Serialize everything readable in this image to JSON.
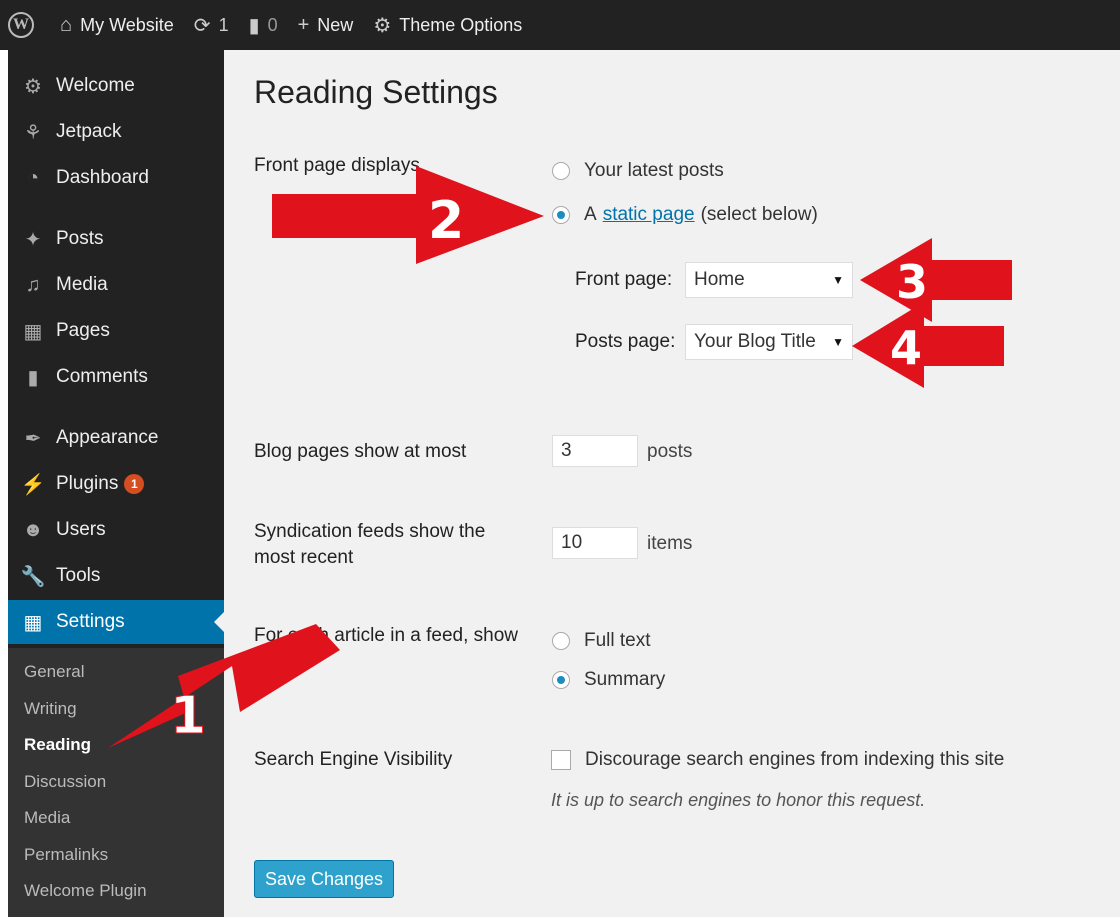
{
  "adminbar": {
    "site_name": "My Website",
    "updates_count": "1",
    "comments_count": "0",
    "new_label": "New",
    "theme_options_label": "Theme Options"
  },
  "sidebar": {
    "items": [
      {
        "label": "Welcome",
        "icon": "gear-icon"
      },
      {
        "label": "Jetpack",
        "icon": "jetpack-icon"
      },
      {
        "label": "Dashboard",
        "icon": "dashboard-icon"
      },
      {
        "label": "Posts",
        "icon": "pin-icon"
      },
      {
        "label": "Media",
        "icon": "media-icon"
      },
      {
        "label": "Pages",
        "icon": "pages-icon"
      },
      {
        "label": "Comments",
        "icon": "comment-icon"
      },
      {
        "label": "Appearance",
        "icon": "brush-icon"
      },
      {
        "label": "Plugins",
        "icon": "plugin-icon",
        "badge": "1"
      },
      {
        "label": "Users",
        "icon": "user-icon"
      },
      {
        "label": "Tools",
        "icon": "wrench-icon"
      },
      {
        "label": "Settings",
        "icon": "settings-icon"
      }
    ],
    "submenu": [
      "General",
      "Writing",
      "Reading",
      "Discussion",
      "Media",
      "Permalinks",
      "Welcome Plugin"
    ]
  },
  "main": {
    "title": "Reading Settings",
    "front_page_displays": {
      "label": "Front page displays",
      "option_latest": "Your latest posts",
      "option_static_prefix": "A",
      "option_static_link": "static page",
      "option_static_suffix": "(select below)",
      "front_page_label": "Front page:",
      "front_page_value": "Home",
      "posts_page_label": "Posts page:",
      "posts_page_value": "Your Blog Title"
    },
    "blog_pages": {
      "label": "Blog pages show at most",
      "value": "3",
      "suffix": "posts"
    },
    "syndication": {
      "label_line1": "Syndication feeds show the",
      "label_line2": "most recent",
      "value": "10",
      "suffix": "items"
    },
    "feed_article": {
      "label": "For each article in a feed, show",
      "option_full": "Full text",
      "option_summary": "Summary"
    },
    "search_visibility": {
      "label": "Search Engine Visibility",
      "checkbox_label": "Discourage search engines from indexing this site",
      "description": "It is up to search engines to honor this request."
    },
    "save_button": "Save Changes"
  },
  "annotations": [
    "1",
    "2",
    "3",
    "4"
  ],
  "colors": {
    "admin_dark": "#222222",
    "active_blue": "#0073aa",
    "button_blue": "#2ea2cc",
    "arrow_red": "#e0121b",
    "badge_orange": "#d54e21"
  }
}
